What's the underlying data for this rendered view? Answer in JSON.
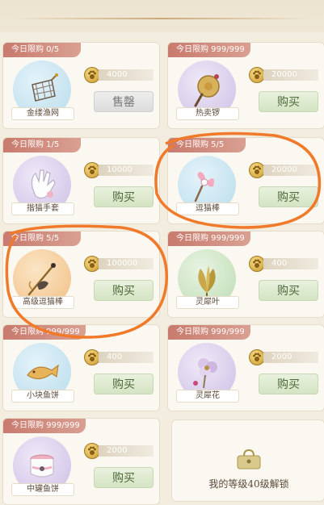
{
  "items": [
    {
      "limit": "今日限购 0/5",
      "name": "金缕渔网",
      "price": "4000",
      "button": "售罄",
      "state": "sold",
      "bg": "blue",
      "icon": "fishing-net-icon"
    },
    {
      "limit": "今日限购 999/999",
      "name": "热卖锣",
      "price": "20000",
      "button": "购买",
      "state": "buy",
      "bg": "purple",
      "icon": "gong-icon"
    },
    {
      "limit": "今日限购 1/5",
      "name": "揩猫手套",
      "price": "10000",
      "button": "购买",
      "state": "buy",
      "bg": "purple",
      "icon": "glove-icon"
    },
    {
      "limit": "今日限购 5/5",
      "name": "逗猫棒",
      "price": "20000",
      "button": "购买",
      "state": "buy",
      "bg": "blue",
      "icon": "cat-teaser-icon"
    },
    {
      "limit": "今日限购 5/5",
      "name": "高级逗猫棒",
      "price": "100000",
      "button": "购买",
      "state": "buy",
      "bg": "orange",
      "icon": "premium-cat-teaser-icon"
    },
    {
      "limit": "今日限购 999/999",
      "name": "灵犀叶",
      "price": "400",
      "button": "购买",
      "state": "buy",
      "bg": "green",
      "icon": "leaf-icon"
    },
    {
      "limit": "今日限购 999/999",
      "name": "小块鱼饼",
      "price": "400",
      "button": "购买",
      "state": "buy",
      "bg": "blue",
      "icon": "fish-cake-icon"
    },
    {
      "limit": "今日限购 999/999",
      "name": "灵犀花",
      "price": "2000",
      "button": "购买",
      "state": "buy",
      "bg": "purple",
      "icon": "flower-icon"
    },
    {
      "limit": "今日限购 999/999",
      "name": "中罐鱼饼",
      "price": "2000",
      "button": "购买",
      "state": "buy",
      "bg": "purple",
      "icon": "canned-fish-icon"
    }
  ],
  "locked_slot": {
    "text": "我的等级40级解锁"
  },
  "colors": {
    "tag": "#c87a6d",
    "annotation": "#f07a2a",
    "buy_text": "#4e6a3c"
  }
}
